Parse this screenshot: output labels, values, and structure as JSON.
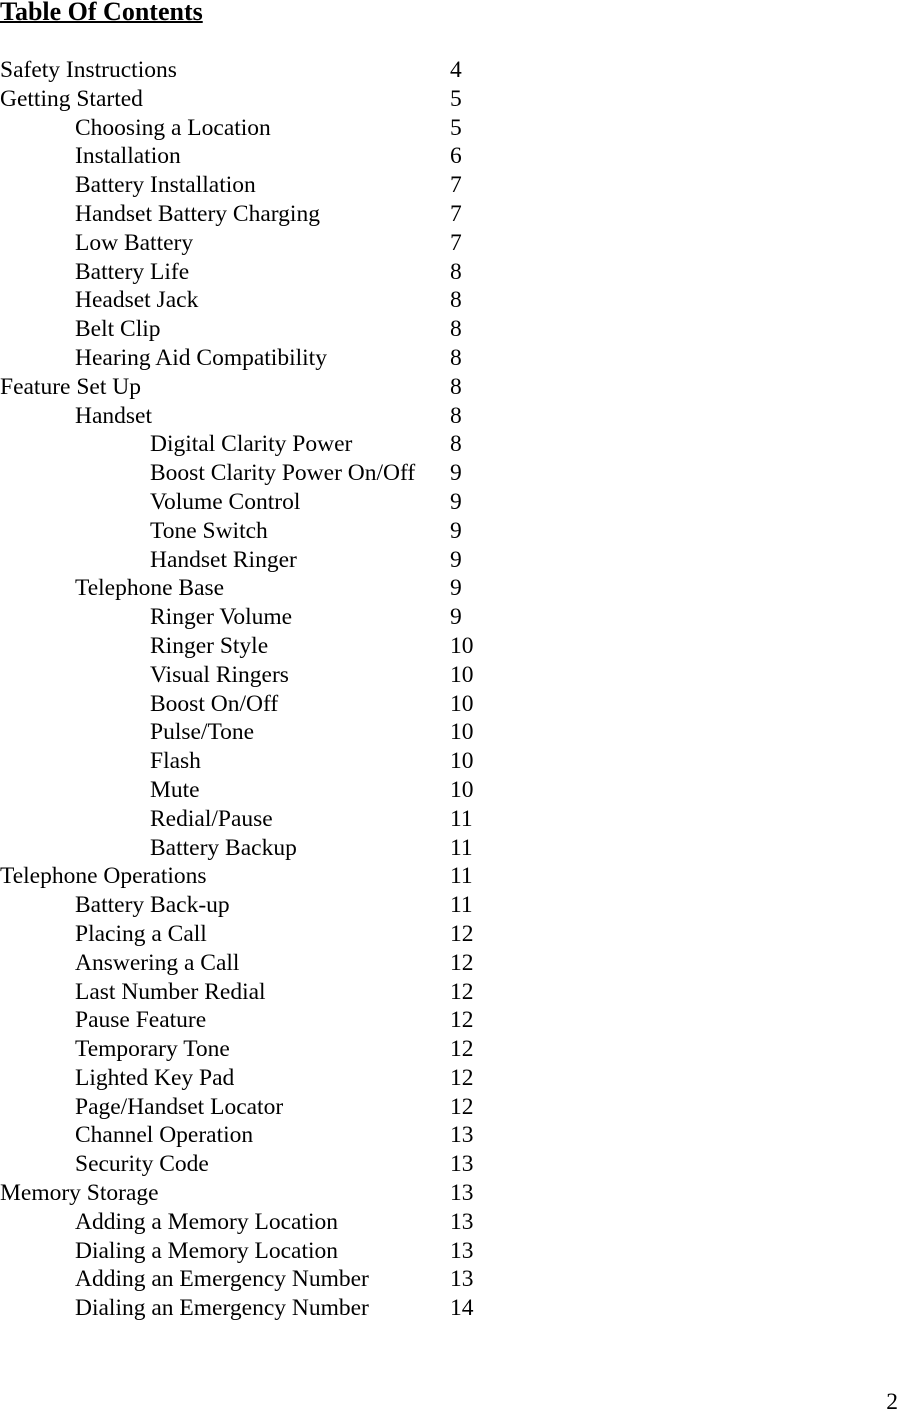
{
  "title": "Table Of Contents",
  "entries": [
    {
      "label": "Safety Instructions",
      "page": "4",
      "level": 0
    },
    {
      "label": "Getting Started",
      "page": "5",
      "level": 0
    },
    {
      "label": "Choosing a Location",
      "page": "5",
      "level": 1
    },
    {
      "label": "Installation",
      "page": "6",
      "level": 1
    },
    {
      "label": "Battery Installation",
      "page": "7",
      "level": 1
    },
    {
      "label": "Handset Battery Charging",
      "page": "7",
      "level": 1
    },
    {
      "label": "Low Battery",
      "page": "7",
      "level": 1
    },
    {
      "label": "Battery Life",
      "page": "8",
      "level": 1
    },
    {
      "label": "Headset Jack",
      "page": "8",
      "level": 1
    },
    {
      "label": "Belt Clip",
      "page": "8",
      "level": 1
    },
    {
      "label": "Hearing Aid Compatibility",
      "page": "8",
      "level": 1
    },
    {
      "label": "Feature Set Up",
      "page": "8",
      "level": 0
    },
    {
      "label": "Handset",
      "page": "8",
      "level": 1
    },
    {
      "label": "Digital Clarity Power",
      "page": "8",
      "level": 2
    },
    {
      "label": "Boost Clarity Power On/Off",
      "page": "9",
      "level": 2
    },
    {
      "label": "Volume Control",
      "page": "9",
      "level": 2
    },
    {
      "label": "Tone Switch",
      "page": "9",
      "level": 2
    },
    {
      "label": "Handset Ringer",
      "page": "9",
      "level": 2
    },
    {
      "label": "Telephone Base",
      "page": "9",
      "level": 1
    },
    {
      "label": "Ringer Volume",
      "page": "9",
      "level": 2
    },
    {
      "label": "Ringer Style",
      "page": "10",
      "level": 2
    },
    {
      "label": "Visual Ringers",
      "page": "10",
      "level": 2
    },
    {
      "label": "Boost On/Off",
      "page": "10",
      "level": 2
    },
    {
      "label": "Pulse/Tone",
      "page": "10",
      "level": 2
    },
    {
      "label": "Flash",
      "page": "10",
      "level": 2
    },
    {
      "label": "Mute",
      "page": "10",
      "level": 2
    },
    {
      "label": "Redial/Pause",
      "page": "11",
      "level": 2
    },
    {
      "label": "Battery Backup",
      "page": "11",
      "level": 2
    },
    {
      "label": "Telephone Operations",
      "page": "11",
      "level": 0
    },
    {
      "label": "Battery Back-up",
      "page": "11",
      "level": 1
    },
    {
      "label": "Placing a Call",
      "page": "12",
      "level": 1
    },
    {
      "label": "Answering a Call",
      "page": "12",
      "level": 1
    },
    {
      "label": "Last Number Redial",
      "page": "12",
      "level": 1
    },
    {
      "label": "Pause Feature",
      "page": "12",
      "level": 1
    },
    {
      "label": "Temporary Tone",
      "page": "12",
      "level": 1
    },
    {
      "label": "Lighted Key Pad",
      "page": "12",
      "level": 1
    },
    {
      "label": "Page/Handset Locator",
      "page": "12",
      "level": 1
    },
    {
      "label": "Channel Operation",
      "page": "13",
      "level": 1
    },
    {
      "label": "Security Code",
      "page": "13",
      "level": 1
    },
    {
      "label": "Memory Storage",
      "page": "13",
      "level": 0
    },
    {
      "label": "Adding a Memory Location",
      "page": "13",
      "level": 1
    },
    {
      "label": "Dialing a Memory Location",
      "page": "13",
      "level": 1
    },
    {
      "label": "Adding an Emergency Number",
      "page": "13",
      "level": 1
    },
    {
      "label": "Dialing an Emergency Number",
      "page": "14",
      "level": 1
    }
  ],
  "footer": {
    "page_number": "2"
  }
}
